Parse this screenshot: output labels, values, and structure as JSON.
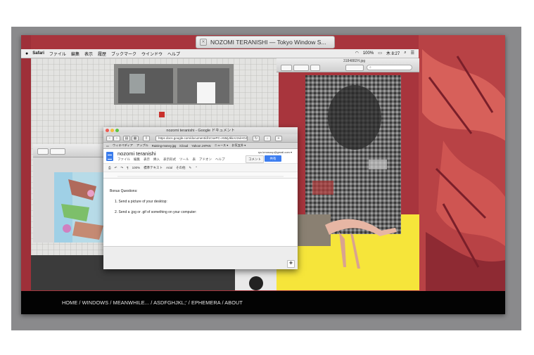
{
  "outer_window": {
    "title": "NOZOMI TERANISHI — Tokyo Window S..."
  },
  "menubar": {
    "app": "Safari",
    "items": [
      "ファイル",
      "編集",
      "表示",
      "履歴",
      "ブックマーク",
      "ウインドウ",
      "ヘルプ"
    ],
    "battery": "100%",
    "clock": "木 8:27"
  },
  "preview_right": {
    "title": "3184882H.jpg"
  },
  "safari": {
    "title": "nozomi teranishi - Google ドキュメント",
    "url": "https  docs.google.com/document/d/1CsePC-A5MjJkkAz2viHOJo",
    "bookmarks": [
      "ウィキペディア",
      "アップル",
      "Raining-money.jpg",
      "iCloud",
      "Yahoo! JAPAN",
      "ニュース ▾",
      "お気五外 ▾"
    ]
  },
  "docs": {
    "doc_title": "nozomi teranishi",
    "menu": [
      "ファイル",
      "編集",
      "表示",
      "挿入",
      "表示形式",
      "ツール",
      "表",
      "アドオン",
      "ヘルプ"
    ],
    "account": "ryu.kmosoup@gmail.com ▾",
    "comment_label": "コメント",
    "share_label": "共有",
    "toolbar": {
      "zoom": "100%",
      "style": "標準テキスト",
      "font": "Arial",
      "more": "その他"
    },
    "body": {
      "heading": "Bonus Questions:",
      "items": [
        "1.  Send a picture of your desktop:",
        "2.  Send a .jpg or .gif of something on your computer:"
      ]
    }
  },
  "bottom_nav": {
    "links": "HOME / WINDOWS / MEANWHILE... / ASDFGHJKL;' / EPHEMERA / ABOUT"
  },
  "colors": {
    "accent": "#3c7df0",
    "yellow": "#f6e53a",
    "red_art": "#c3484a"
  }
}
